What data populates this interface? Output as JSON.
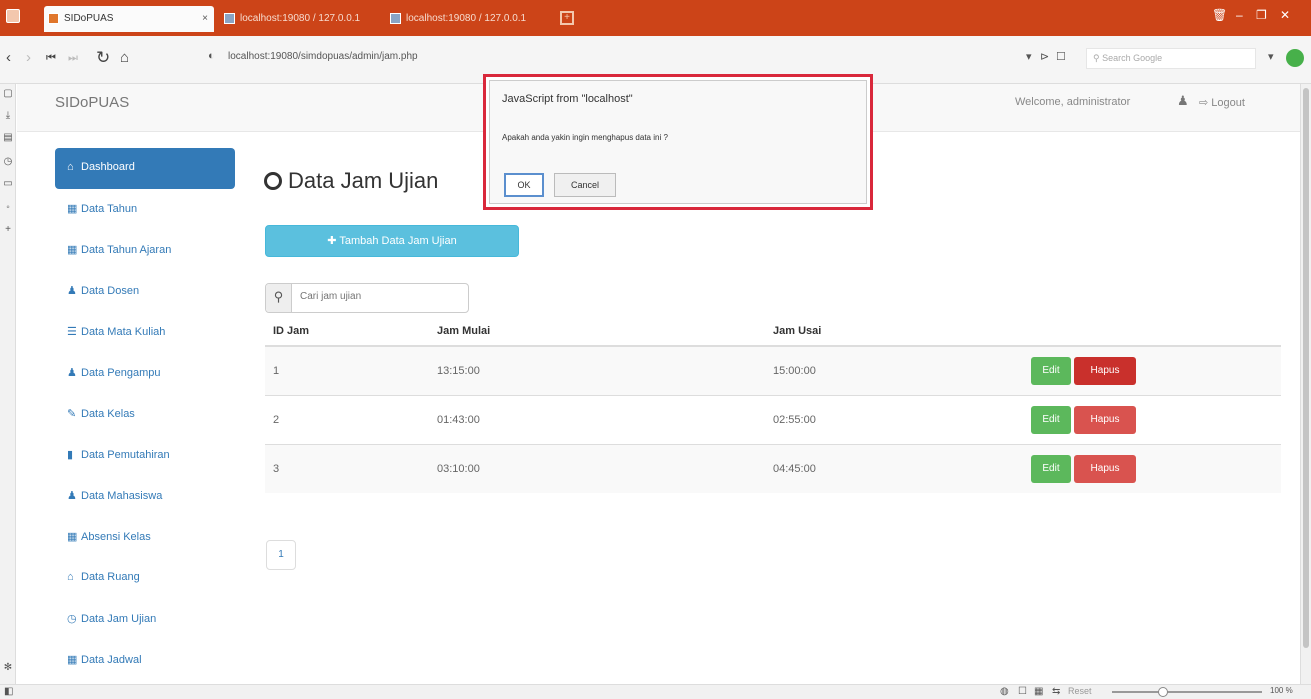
{
  "browser": {
    "tabs": [
      {
        "title": "SIDoPUAS",
        "active": true
      },
      {
        "title": "localhost:19080 / 127.0.0.1",
        "active": false
      },
      {
        "title": "localhost:19080 / 127.0.0.1",
        "active": false
      }
    ],
    "tab_close": "×",
    "new_tab": "+",
    "address": "localhost:19080/simdopuas/admin/jam.php",
    "search_placeholder": "Search Google",
    "window_controls": {
      "minimize": "‒",
      "restore": "❐",
      "close": "✕"
    }
  },
  "header": {
    "brand": "SIDoPUAS",
    "welcome": "Welcome, administrator",
    "logout": "Logout"
  },
  "sidebar": {
    "items": [
      {
        "label": "Dashboard",
        "icon": "home-icon",
        "active": true
      },
      {
        "label": "Data Tahun",
        "icon": "grid-icon"
      },
      {
        "label": "Data Tahun Ajaran",
        "icon": "grid-icon"
      },
      {
        "label": "Data Dosen",
        "icon": "user-icon"
      },
      {
        "label": "Data Mata Kuliah",
        "icon": "list-icon"
      },
      {
        "label": "Data Pengampu",
        "icon": "user-icon"
      },
      {
        "label": "Data Kelas",
        "icon": "pencil-icon"
      },
      {
        "label": "Data Pemutahiran",
        "icon": "book-icon"
      },
      {
        "label": "Data Mahasiswa",
        "icon": "user-icon"
      },
      {
        "label": "Absensi Kelas",
        "icon": "grid-icon"
      },
      {
        "label": "Data Ruang",
        "icon": "home-icon"
      },
      {
        "label": "Data Jam Ujian",
        "icon": "clock-icon"
      },
      {
        "label": "Data Jadwal",
        "icon": "grid-icon"
      }
    ]
  },
  "main": {
    "title": "Data Jam Ujian",
    "add_button": "Tambah Data Jam Ujian",
    "search_placeholder": "Cari jam ujian",
    "table": {
      "headers": [
        "ID Jam",
        "Jam Mulai",
        "Jam Usai",
        ""
      ],
      "rows": [
        {
          "id": "1",
          "mulai": "13:15:00",
          "usai": "15:00:00"
        },
        {
          "id": "2",
          "mulai": "01:43:00",
          "usai": "02:55:00"
        },
        {
          "id": "3",
          "mulai": "03:10:00",
          "usai": "04:45:00"
        }
      ],
      "edit_label": "Edit",
      "delete_label": "Hapus"
    },
    "pagination": [
      "1"
    ]
  },
  "dialog": {
    "title": "JavaScript from \"localhost\"",
    "message": "Apakah anda yakin ingin menghapus data ini ?",
    "ok": "OK",
    "cancel": "Cancel"
  },
  "statusbar": {
    "zoom_label": "Reset",
    "zoom": "100 %"
  }
}
